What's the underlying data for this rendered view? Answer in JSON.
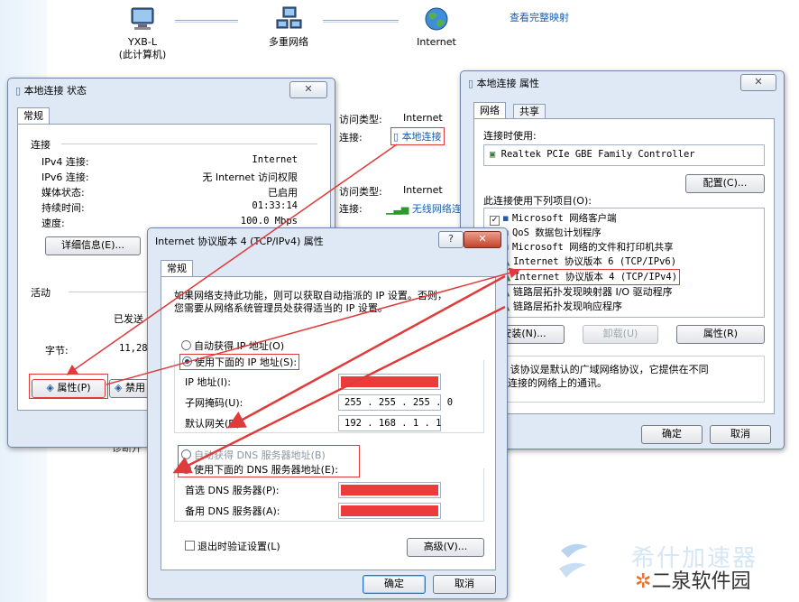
{
  "network_map": {
    "node1_name": "YXB-L",
    "node1_sub": "(此计算机)",
    "node2_name": "多重网络",
    "node3_name": "Internet",
    "full_map_link": "查看完整映射",
    "access_type_label1": "访问类型:",
    "access_type_value1": "Internet",
    "connection_label1": "连接:",
    "connection_value1": "本地连接",
    "access_type_label2": "访问类型:",
    "access_type_value2": "Internet",
    "connection_label2": "连接:",
    "connection_value2": "无线网络连",
    "diag_partial": "诊断开"
  },
  "status_window": {
    "title": "本地连接 状态",
    "tab_general": "常规",
    "group_connection": "连接",
    "ipv4_label": "IPv4 连接:",
    "ipv4_value": "Internet",
    "ipv6_label": "IPv6 连接:",
    "ipv6_value": "无 Internet 访问权限",
    "media_label": "媒体状态:",
    "media_value": "已启用",
    "duration_label": "持续时间:",
    "duration_value": "01:33:14",
    "speed_label": "速度:",
    "speed_value": "100.0 Mbps",
    "details_button": "详细信息(E)...",
    "group_activity": "活动",
    "sent_label": "已发送",
    "bytes_label": "字节:",
    "bytes_value": "11,28",
    "properties_button": "属性(P)",
    "disable_button": "禁用"
  },
  "props_window": {
    "title": "本地连接 属性",
    "tab_network": "网络",
    "tab_sharing": "共享",
    "connect_using": "连接时使用:",
    "adapter": "Realtek PCIe GBE Family Controller",
    "configure_button": "配置(C)...",
    "items_label": "此连接使用下列项目(O):",
    "items": [
      "Microsoft 网络客户端",
      "QoS 数据包计划程序",
      "Microsoft 网络的文件和打印机共享",
      "Internet 协议版本 6 (TCP/IPv6)",
      "Internet 协议版本 4 (TCP/IPv4)",
      "链路层拓扑发现映射器 I/O 驱动程序",
      "链路层拓扑发现响应程序"
    ],
    "install_button": "安装(N)...",
    "uninstall_button": "卸载(U)",
    "properties_button": "属性(R)",
    "description_line1": "/IP。该协议是默认的广域网络协议，它提供在不同",
    "description_line2": "相互连接的网络上的通讯。",
    "desc_partial": "述",
    "ok_button": "确定",
    "cancel_button": "取消"
  },
  "ipv4_window": {
    "title": "Internet 协议版本 4 (TCP/IPv4) 属性",
    "help_button": "?",
    "close_button": "✕",
    "tab_general": "常规",
    "intro_line1": "如果网络支持此功能，则可以获取自动指派的 IP 设置。否则，",
    "intro_line2": "您需要从网络系统管理员处获得适当的 IP 设置。",
    "auto_ip": "自动获得 IP 地址(O)",
    "manual_ip": "使用下面的 IP 地址(S):",
    "ip_label": "IP 地址(I):",
    "subnet_label": "子网掩码(U):",
    "subnet_value": "255 . 255 . 255 .  0",
    "gateway_label": "默认网关(D):",
    "gateway_value": "192 . 168 .  1  .  1",
    "auto_dns": "自动获得 DNS 服务器地址(B)",
    "manual_dns": "使用下面的 DNS 服务器地址(E):",
    "pref_dns_label": "首选 DNS 服务器(P):",
    "alt_dns_label": "备用 DNS 服务器(A):",
    "validate_label": "退出时验证设置(L)",
    "advanced_button": "高级(V)...",
    "ok_button": "确定",
    "cancel_button": "取消"
  },
  "watermark": {
    "site_name": "二泉软件园",
    "faded_text": "希什加速器"
  },
  "colors": {
    "annotation_red": "#e03b3b",
    "redact": "#ec3b3b",
    "link_blue": "#1b5fb5",
    "window_frame": "#dfe9f6"
  }
}
